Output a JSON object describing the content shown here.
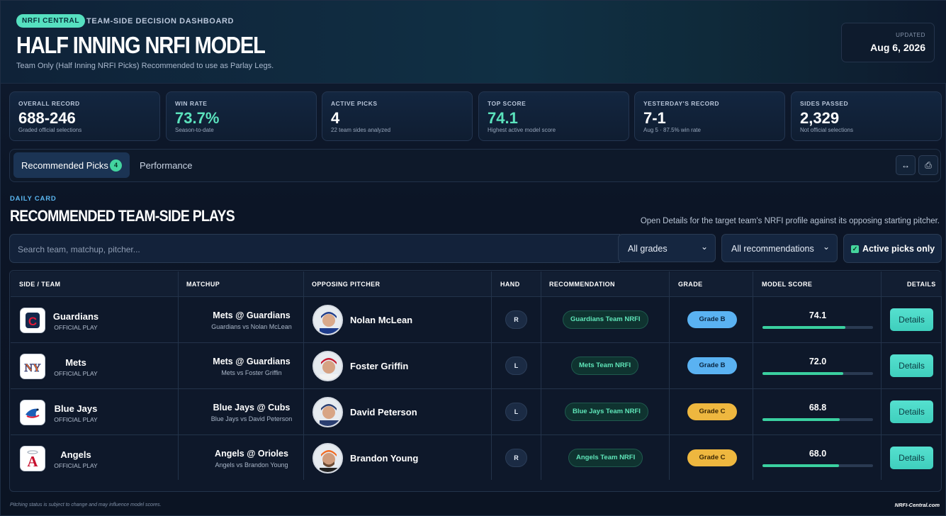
{
  "header": {
    "brand": "NRFI CENTRAL",
    "eyebrow": "TEAM-SIDE DECISION DASHBOARD",
    "title": "HALF INNING NRFI MODEL",
    "subtitle": "Team Only (Half Inning NRFI Picks) Recommended to use as Parlay Legs.",
    "updated_label": "UPDATED",
    "updated_value": "Aug 6, 2026"
  },
  "stats": [
    {
      "label": "OVERALL RECORD",
      "value": "688-246",
      "note": "Graded official selections"
    },
    {
      "label": "WIN RATE",
      "value": "73.7%",
      "note": "Season-to-date"
    },
    {
      "label": "ACTIVE PICKS",
      "value": "4",
      "note": "22 team sides analyzed"
    },
    {
      "label": "TOP SCORE",
      "value": "74.1",
      "note": "Highest active model score"
    },
    {
      "label": "YESTERDAY'S RECORD",
      "value": "7-1",
      "note": "Aug 5 · 87.5% win rate"
    },
    {
      "label": "SIDES PASSED",
      "value": "2,329",
      "note": "Not official selections"
    }
  ],
  "tabs": {
    "recommended": "Recommended Picks",
    "recommended_count": "4",
    "performance": "Performance"
  },
  "toolbar": {
    "expand_icon": "↔",
    "share_icon": "⎙"
  },
  "section": {
    "eyebrow": "DAILY CARD",
    "title": "RECOMMENDED TEAM-SIDE PLAYS",
    "hint": "Open Details for the target team's NRFI profile against its opposing starting pitcher."
  },
  "filters": {
    "search_placeholder": "Search team, matchup, pitcher...",
    "grade_select": "All grades",
    "recommendation_select": "All recommendations",
    "active_only_label": "Active picks only"
  },
  "table": {
    "headers": [
      "SIDE / TEAM",
      "MATCHUP",
      "OPPOSING PITCHER",
      "HAND",
      "RECOMMENDATION",
      "GRADE",
      "MODEL SCORE",
      "DETAILS"
    ],
    "rows": [
      {
        "team": "Guardians",
        "tag": "OFFICIAL PLAY",
        "matchup": "Mets @ Guardians",
        "matchup_sub": "Guardians vs Nolan McLean",
        "pitcher": "Nolan McLean",
        "hand": "R",
        "recommendation": "Guardians Team NRFI",
        "grade": "Grade B",
        "score": "74.1",
        "score_pct": 0.75,
        "details": "Details",
        "logo_color": "#d5223a",
        "logo_text": "C"
      },
      {
        "team": "Mets",
        "tag": "OFFICIAL PLAY",
        "matchup": "Mets @ Guardians",
        "matchup_sub": "Mets vs Foster Griffin",
        "pitcher": "Foster Griffin",
        "hand": "L",
        "recommendation": "Mets Team NRFI",
        "grade": "Grade B",
        "score": "72.0",
        "score_pct": 0.73,
        "details": "Details",
        "logo_color": "#f26b21",
        "logo_text": "NY"
      },
      {
        "team": "Blue Jays",
        "tag": "OFFICIAL PLAY",
        "matchup": "Blue Jays @ Cubs",
        "matchup_sub": "Blue Jays vs David Peterson",
        "pitcher": "David Peterson",
        "hand": "L",
        "recommendation": "Blue Jays Team NRFI",
        "grade": "Grade C",
        "score": "68.8",
        "score_pct": 0.7,
        "details": "Details",
        "logo_color": "#1d5fb8",
        "logo_text": "TOR"
      },
      {
        "team": "Angels",
        "tag": "OFFICIAL PLAY",
        "matchup": "Angels @ Orioles",
        "matchup_sub": "Angels vs Brandon Young",
        "pitcher": "Brandon Young",
        "hand": "R",
        "recommendation": "Angels Team NRFI",
        "grade": "Grade C",
        "score": "68.0",
        "score_pct": 0.69,
        "details": "Details",
        "logo_color": "#c8102e",
        "logo_text": "A"
      }
    ]
  },
  "footer": {
    "note": "Pitching status is subject to change and may influence model scores.",
    "brand": "NRFI-Central.com"
  },
  "colors": {
    "accent": "#5be3bd",
    "grade_b": "#5ab2f2",
    "grade_c": "#eeb73f",
    "details_button": "#4fd9c8"
  }
}
